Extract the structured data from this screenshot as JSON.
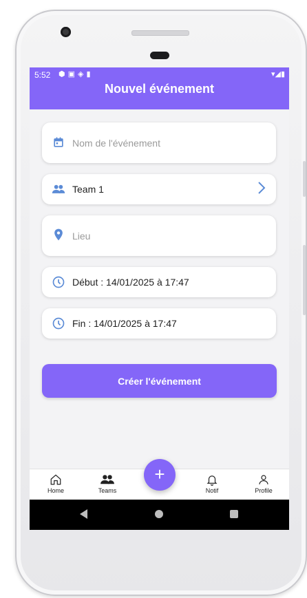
{
  "status_bar": {
    "time": "5:52",
    "left_icons": [
      "android-icon",
      "a-icon",
      "play-icon",
      "sim-icon"
    ],
    "right_icons": [
      "wifi-icon",
      "signal-icon",
      "battery-icon"
    ]
  },
  "header": {
    "title": "Nouvel événement"
  },
  "form": {
    "name_placeholder": "Nom de l'événement",
    "team_value": "Team 1",
    "location_placeholder": "Lieu",
    "start_label": "Début : 14/01/2025 à 17:47",
    "end_label": "Fin : 14/01/2025 à 17:47"
  },
  "actions": {
    "create_label": "Créer l'événement"
  },
  "tabbar": {
    "items": [
      {
        "label": "Home",
        "icon": "home-icon"
      },
      {
        "label": "Teams",
        "icon": "people-icon"
      },
      {
        "label": "Notif",
        "icon": "bell-icon"
      },
      {
        "label": "Profile",
        "icon": "user-icon"
      }
    ],
    "fab_icon": "plus-icon"
  },
  "colors": {
    "accent": "#8466f8",
    "icon_blue": "#5b8bd6",
    "background": "#f3f3f5"
  }
}
